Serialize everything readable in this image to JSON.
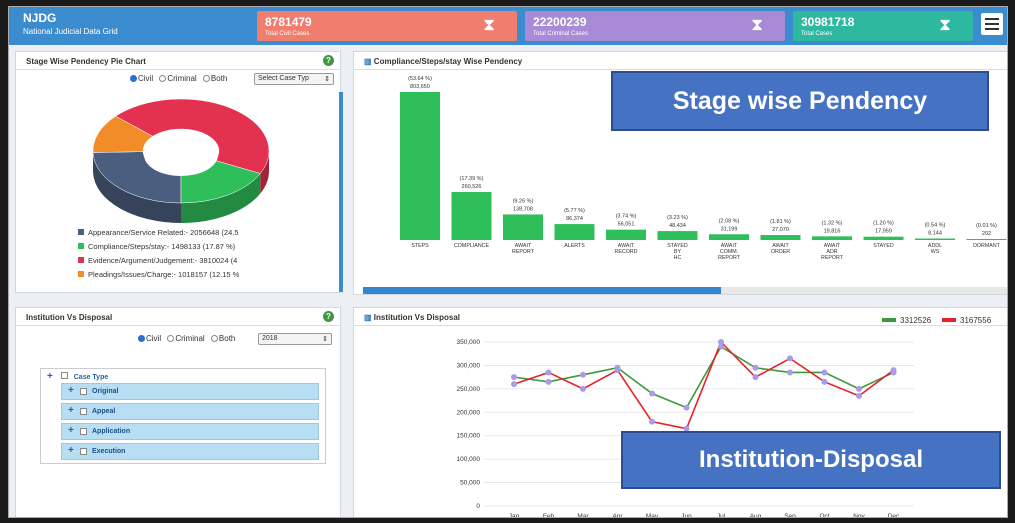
{
  "header": {
    "title": "NJDG",
    "subtitle": "National Judicial Data Grid",
    "stats": [
      {
        "value": "8781479",
        "label": "Total Civil Cases",
        "color": "#f07e6e"
      },
      {
        "value": "22200239",
        "label": "Total Criminal Cases",
        "color": "#a98ad6"
      },
      {
        "value": "30981718",
        "label": "Total Cases",
        "color": "#2fb8a0"
      }
    ]
  },
  "pie_panel": {
    "title": "Stage Wise Pendency Pie Chart",
    "radios": [
      "Civil",
      "Criminal",
      "Both"
    ],
    "selected_radio": "Civil",
    "select_placeholder": "Select Case Typ",
    "legend": [
      {
        "label": "Appearance/Service Related:- 2056648 (24.5",
        "color": "#4a5f7f"
      },
      {
        "label": "Compliance/Steps/stay:- 1498133 (17.87 %)",
        "color": "#2fbf5a"
      },
      {
        "label": "Evidence/Argument/Judgement:- 3810024 (4",
        "color": "#e2324f"
      },
      {
        "label": "Pleadings/Issues/Charge:- 1018157 (12.15 %",
        "color": "#f28c28"
      }
    ]
  },
  "bar_panel": {
    "title": "Compliance/Steps/stay Wise Pendency",
    "overlay": "Stage wise Pendency"
  },
  "inst_panel": {
    "title": "Institution Vs Disposal",
    "radios": [
      "Civil",
      "Criminal",
      "Both"
    ],
    "selected_radio": "Civil",
    "year": "2018",
    "tree_root": "Case Type",
    "tree_items": [
      "Original",
      "Appeal",
      "Application",
      "Execution"
    ]
  },
  "line_panel": {
    "title": "Institution Vs Disposal",
    "overlay": "Institution-Disposal",
    "x_caption_green": "Institution",
    "x_caption_red": "Disposal"
  },
  "chart_data": [
    {
      "type": "pie",
      "title": "Stage Wise Pendency Pie Chart",
      "labels": [
        "Appearance/Service Related",
        "Compliance/Steps/stay",
        "Evidence/Argument/Judgement",
        "Pleadings/Issues/Charge"
      ],
      "values": [
        2056648,
        1498133,
        3810024,
        1018157
      ],
      "colors": [
        "#4a5f7f",
        "#2fbf5a",
        "#e2324f",
        "#f28c28"
      ]
    },
    {
      "type": "bar",
      "title": "Compliance/Steps/stay Wise Pendency",
      "categories": [
        "STEPS",
        "COMPLIANCE",
        "AWAIT REPORT",
        "ALERTS",
        "AWAIT RECORD",
        "STAYED BY HC",
        "AWAIT COMM. REPORT",
        "AWAIT ORDER",
        "AWAIT ADR REPORT",
        "STAYED",
        "ADDL WS",
        "DORMANT"
      ],
      "values": [
        803650,
        260526,
        138708,
        86374,
        56051,
        48434,
        31199,
        27070,
        19816,
        17959,
        8144,
        202
      ],
      "percent_labels": [
        "(53.64 %)",
        "(17.39 %)",
        "(9.26 %)",
        "(5.77 %)",
        "(3.74 %)",
        "(3.23 %)",
        "(2.08 %)",
        "(1.81 %)",
        "(1.32 %)",
        "(1.20 %)",
        "(0.54 %)",
        "(0.01 %)"
      ],
      "color": "#2fbf5a"
    },
    {
      "type": "line",
      "title": "Institution Vs Disposal",
      "categories": [
        "Jan",
        "Feb",
        "Mar",
        "Apr",
        "May",
        "Jun",
        "Jul",
        "Aug",
        "Sep",
        "Oct",
        "Nov",
        "Dec"
      ],
      "ylim": [
        0,
        350000
      ],
      "yticks": [
        "0",
        "50,000",
        "100,000",
        "150,000",
        "200,000",
        "250,000",
        "300,000",
        "350,000"
      ],
      "series": [
        {
          "name": "3312526",
          "color": "#3c9a3c",
          "values": [
            275000,
            265000,
            280000,
            295000,
            240000,
            210000,
            340000,
            295000,
            285000,
            285000,
            250000,
            285000
          ]
        },
        {
          "name": "3167556",
          "color": "#e8202a",
          "values": [
            260000,
            285000,
            250000,
            290000,
            180000,
            165000,
            350000,
            275000,
            315000,
            265000,
            235000,
            290000
          ]
        }
      ]
    }
  ]
}
